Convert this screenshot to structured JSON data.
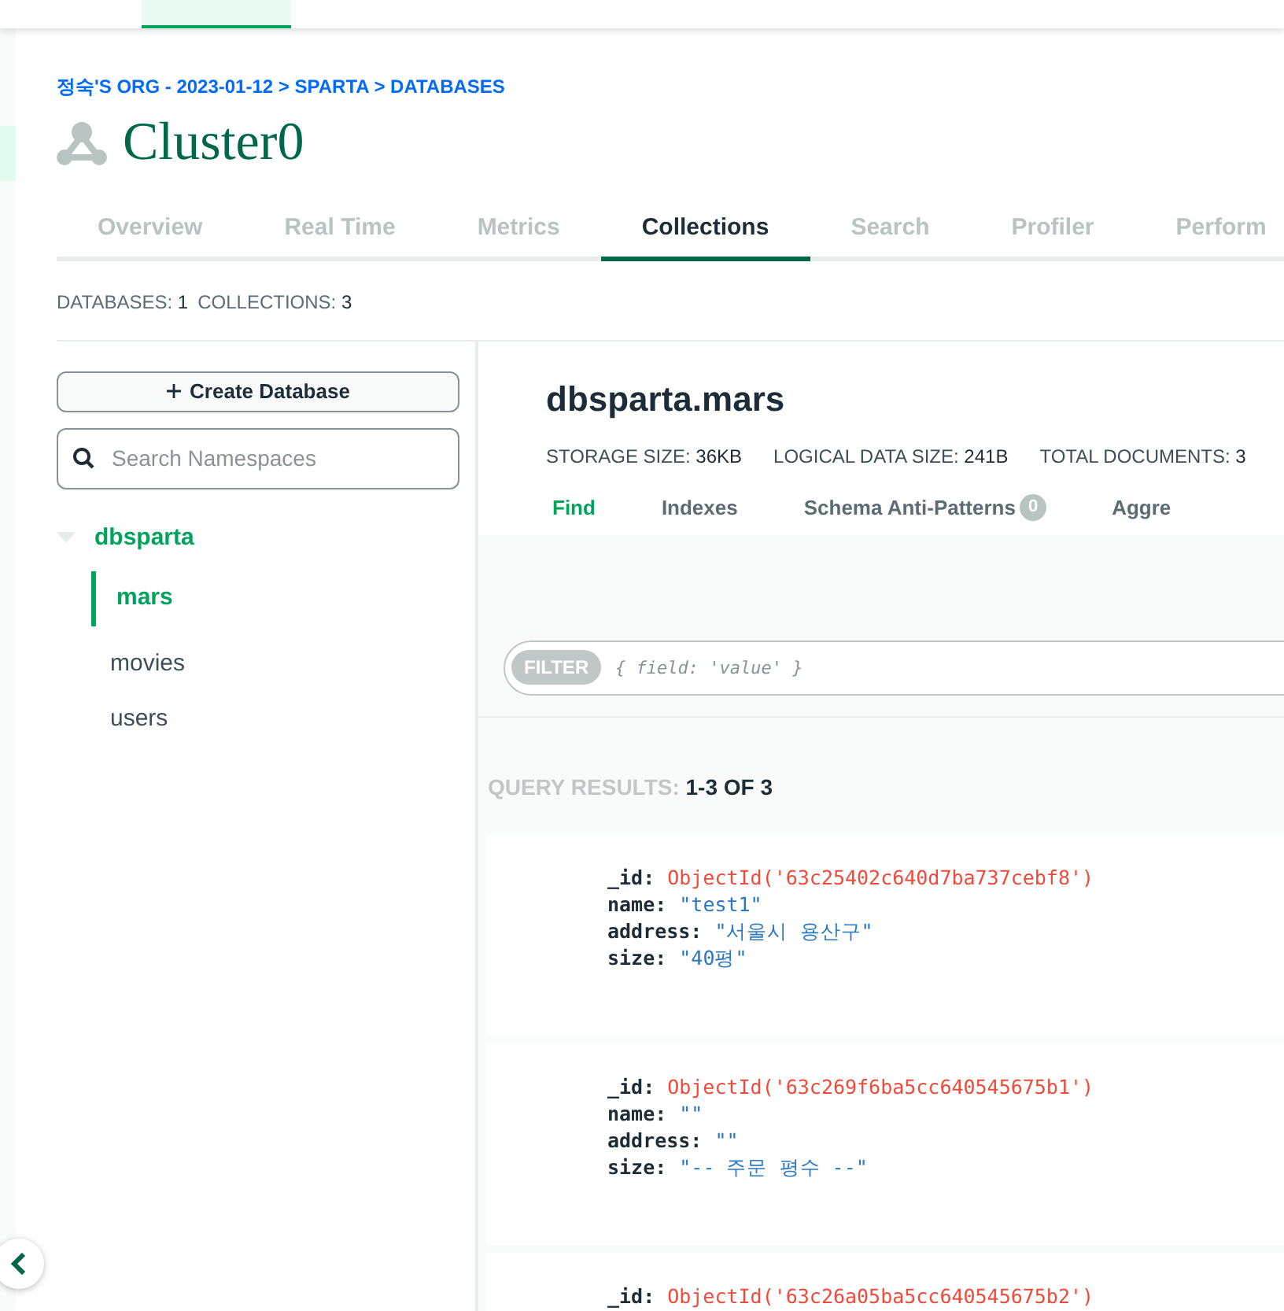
{
  "breadcrumb": "정숙'S ORG - 2023-01-12 > SPARTA > DATABASES",
  "cluster": {
    "title": "Cluster0"
  },
  "tabs": [
    {
      "label": "Overview",
      "selected": false
    },
    {
      "label": "Real Time",
      "selected": false
    },
    {
      "label": "Metrics",
      "selected": false
    },
    {
      "label": "Collections",
      "selected": true
    },
    {
      "label": "Search",
      "selected": false
    },
    {
      "label": "Profiler",
      "selected": false
    },
    {
      "label": "Perform",
      "selected": false
    }
  ],
  "stats": [
    {
      "label": "DATABASES:",
      "value": "1"
    },
    {
      "label": "COLLECTIONS:",
      "value": "3"
    }
  ],
  "sidebar": {
    "create_button": "Create Database",
    "search": {
      "placeholder": "Search Namespaces"
    },
    "tree": [
      {
        "label": "dbsparta",
        "expanded": true,
        "children": [
          {
            "label": "mars",
            "selected": true
          },
          {
            "label": "movies",
            "selected": false
          },
          {
            "label": "users",
            "selected": false
          }
        ]
      }
    ]
  },
  "collection": {
    "title": "dbsparta.mars",
    "stats": [
      {
        "label": "STORAGE SIZE:",
        "value": "36KB"
      },
      {
        "label": "LOGICAL DATA SIZE:",
        "value": "241B"
      },
      {
        "label": "TOTAL DOCUMENTS:",
        "value": "3"
      }
    ],
    "tabs": [
      {
        "label": "Find",
        "selected": true
      },
      {
        "label": "Indexes",
        "selected": false
      },
      {
        "label": "Schema Anti-Patterns",
        "badge": "0",
        "selected": false
      },
      {
        "label": "Aggre",
        "selected": false
      }
    ],
    "filter": {
      "label": "FILTER",
      "placeholder": "{ field: 'value' }"
    },
    "results": {
      "label": "QUERY RESULTS:",
      "value": "1-3 OF 3"
    },
    "documents": [
      {
        "fields": [
          {
            "key": "_id:",
            "value": "ObjectId('63c25402c640d7ba737cebf8')",
            "kind": "objectid"
          },
          {
            "key": "name:",
            "value": "\"test1\"",
            "kind": "string"
          },
          {
            "key": "address:",
            "value": "\"서울시 용산구\"",
            "kind": "string"
          },
          {
            "key": "size:",
            "value": "\"40평\"",
            "kind": "string"
          }
        ]
      },
      {
        "fields": [
          {
            "key": "_id:",
            "value": "ObjectId('63c269f6ba5cc640545675b1')",
            "kind": "objectid"
          },
          {
            "key": "name:",
            "value": "\"\"",
            "kind": "string"
          },
          {
            "key": "address:",
            "value": "\"\"",
            "kind": "string"
          },
          {
            "key": "size:",
            "value": "\"-- 주문 평수 --\"",
            "kind": "string"
          }
        ]
      },
      {
        "fields": [
          {
            "key": "_id:",
            "value": "ObjectId('63c26a05ba5cc640545675b2')",
            "kind": "objectid"
          }
        ]
      }
    ]
  }
}
